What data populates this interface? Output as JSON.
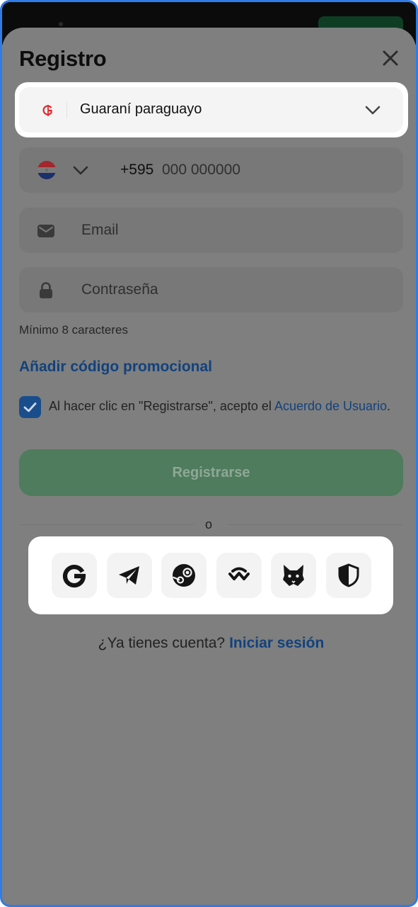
{
  "header": {
    "title": "Registro"
  },
  "currency": {
    "label": "Guaraní paraguayo",
    "icon": "guarani-icon"
  },
  "phone": {
    "prefix": "+595",
    "placeholder": "000 000000",
    "flag": "paraguay-flag-icon"
  },
  "email": {
    "placeholder": "Email"
  },
  "password": {
    "placeholder": "Contraseña",
    "hint": "Mínimo 8 caracteres"
  },
  "promo_link": "Añadir código promocional",
  "terms": {
    "checked": true,
    "text": "Al hacer clic en \"Registrarse\", acepto el ",
    "link": "Acuerdo de Usuario",
    "end": "."
  },
  "register_button": "Registrarse",
  "divider": "o",
  "social": [
    "google-icon",
    "telegram-icon",
    "steam-icon",
    "walletconnect-icon",
    "metamask-fox-icon",
    "shield-icon"
  ],
  "footer": {
    "question": "¿Ya tienes cuenta?",
    "signin": "Iniciar sesión"
  },
  "colors": {
    "accent_link": "#12427d",
    "register_bg": "#4e7c5d",
    "overlay": "#7f7f7f",
    "frame_border": "#2f7be8"
  }
}
